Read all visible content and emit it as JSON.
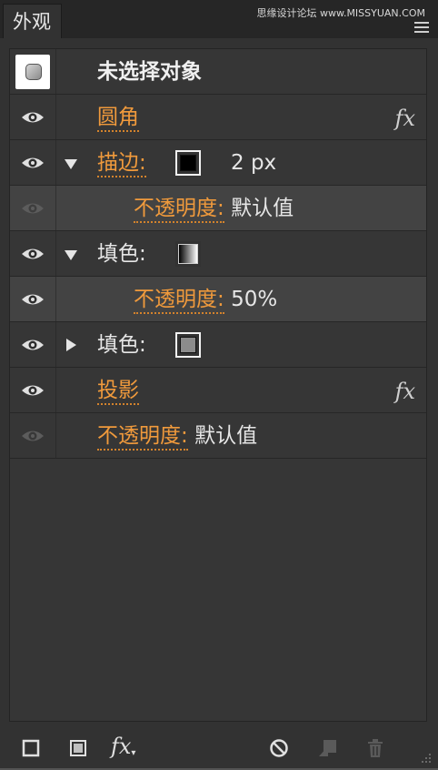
{
  "panel": {
    "tab_label": "外观",
    "watermark": "思缘设计论坛 www.MISSYUAN.COM"
  },
  "rows": {
    "object_label": "未选择对象",
    "rounded_corners": "圆角",
    "stroke_label": "描边:",
    "stroke_weight": "2 px",
    "stroke_opacity_label": "不透明度:",
    "stroke_opacity_value": "默认值",
    "fill1_label": "填色:",
    "fill1_opacity_label": "不透明度:",
    "fill1_opacity_value": "50%",
    "fill2_label": "填色:",
    "drop_shadow": "投影",
    "opacity_label": "不透明度:",
    "opacity_value": "默认值",
    "fx_symbol": "fx"
  },
  "toolbar": {
    "fx_menu_label": "fx"
  },
  "colors": {
    "link_orange": "#f09a3c",
    "stroke_swatch": "#000000",
    "fill2_swatch": "#8c8c8c"
  },
  "icons": [
    "eye-icon",
    "disclosure-triangle-icon",
    "add-stroke-icon",
    "add-fill-icon",
    "fx-icon",
    "clear-appearance-icon",
    "duplicate-item-icon",
    "delete-icon",
    "resize-grip-icon"
  ]
}
